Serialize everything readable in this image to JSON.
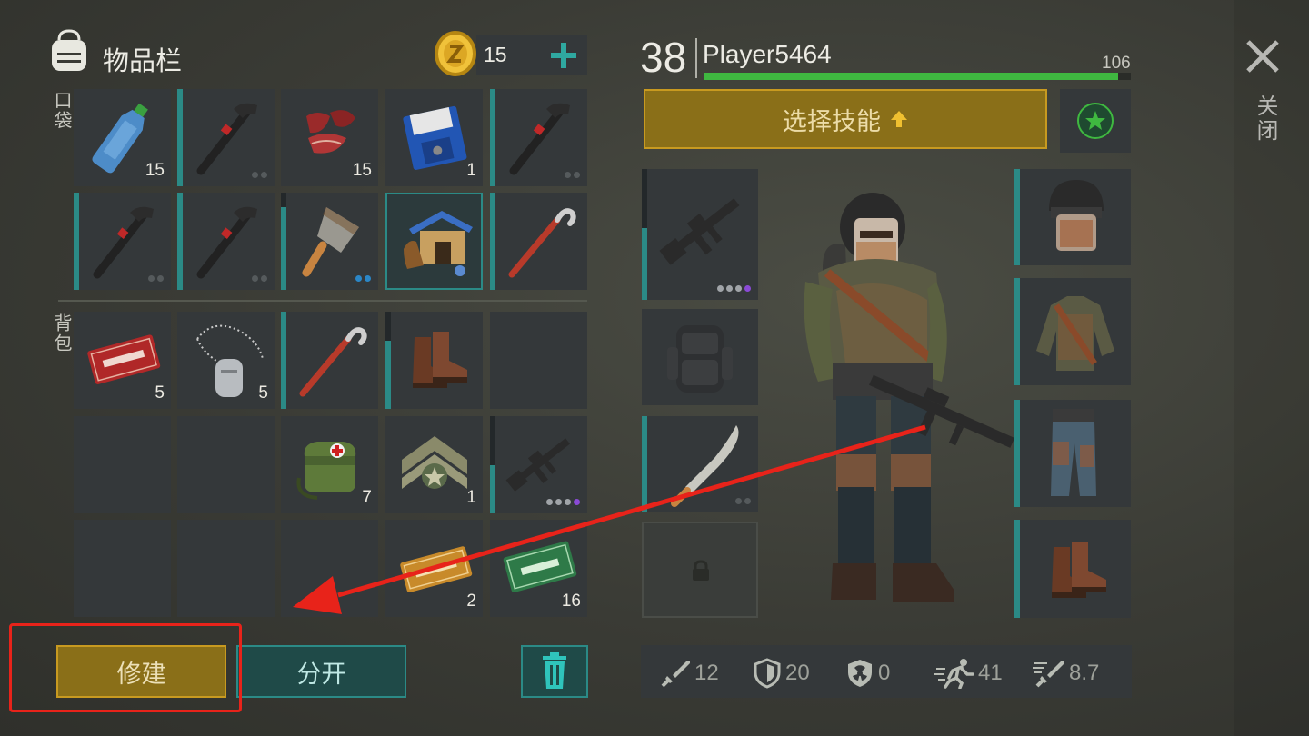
{
  "inventory": {
    "title": "物品栏",
    "pockets_label": "口袋",
    "backpack_label": "背包",
    "coins": "15"
  },
  "player": {
    "level": "38",
    "name": "Player5464",
    "xp": "106",
    "xp_progress": 0.97
  },
  "skills_button": "选择技能",
  "close_label": "关闭",
  "buttons": {
    "build": "修建",
    "split": "分开"
  },
  "stats": {
    "attack": "12",
    "defense": "20",
    "radiation": "0",
    "speed": "41",
    "attack_speed": "8.7"
  },
  "slots": {
    "water_bottle": "15",
    "meat": "15",
    "floppy_disk": "1",
    "combat_coupon": "5",
    "dog_tag": "5",
    "medkit_bag": "7",
    "chevron": "1",
    "survival_kit": "2",
    "ration_coupon": "16"
  },
  "colors": {
    "accent_teal": "#2b8a86",
    "xp_green": "#3fb840",
    "skill_gold": "#8a6f18",
    "highlight_red": "#e8231a"
  }
}
